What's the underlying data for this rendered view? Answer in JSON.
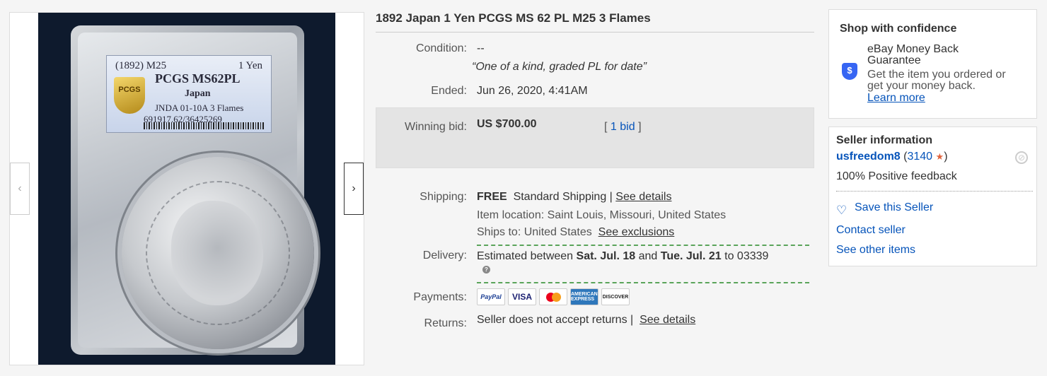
{
  "product": {
    "title": "1892 Japan 1 Yen PCGS MS 62 PL M25 3 Flames"
  },
  "photo_label": {
    "year_line": "(1892) M25",
    "denom": "1 Yen",
    "grade": "PCGS MS62PL",
    "country": "Japan",
    "variety": "JNDA 01-10A 3 Flames",
    "cert": "691917.62/36425269",
    "logo": "PCGS"
  },
  "gallery": {
    "prev_icon": "‹",
    "next_icon": "›"
  },
  "details": {
    "condition_label": "Condition:",
    "condition_value": "--",
    "quote": "“One of a kind, graded PL for date”",
    "ended_label": "Ended:",
    "ended_date": "Jun 26, 2020",
    "ended_time": ", 4:41AM",
    "winning_label": "Winning bid:",
    "winning_price": "US $700.00",
    "bids_open": "[",
    "bids_link": "1 bid",
    "bids_close": "]",
    "shipping_label": "Shipping:",
    "shipping_free": "FREE",
    "shipping_method": "Standard Shipping |",
    "shipping_details_link": "See details",
    "item_location": "Item location: Saint Louis, Missouri, United States",
    "ships_to": "Ships to: United States",
    "exclusions_link": "See exclusions",
    "delivery_label": "Delivery:",
    "delivery_prefix": "Estimated between",
    "delivery_start": "Sat. Jul. 18",
    "delivery_and": "and",
    "delivery_end": "Tue. Jul. 21",
    "delivery_zip": "to 03339",
    "payments_label": "Payments:",
    "returns_label": "Returns:",
    "returns_text": "Seller does not accept returns |",
    "returns_details_link": "See details"
  },
  "payments": {
    "paypal": "PayPal",
    "visa": "VISA",
    "amex": "AMERICAN EXPRESS",
    "discover": "DISCOVER"
  },
  "confidence": {
    "heading": "Shop with confidence",
    "guarantee_line1": "eBay Money Back",
    "guarantee_line2": "Guarantee",
    "desc_line1": "Get the item you ordered or",
    "desc_line2": "get your money back.",
    "learn_more": "Learn more",
    "icon": "$"
  },
  "seller": {
    "heading": "Seller information",
    "name": "usfreedom8",
    "score_open": "(",
    "score": "3140",
    "star": "★",
    "score_close": ")",
    "feedback": "100% Positive feedback",
    "save_seller": "Save this Seller",
    "contact": "Contact seller",
    "other_items": "See other items"
  },
  "colors": {
    "link": "#0654ba",
    "bid_box": "#e4e4e4",
    "dash_green": "#5aa45a",
    "star": "#e0643e"
  }
}
